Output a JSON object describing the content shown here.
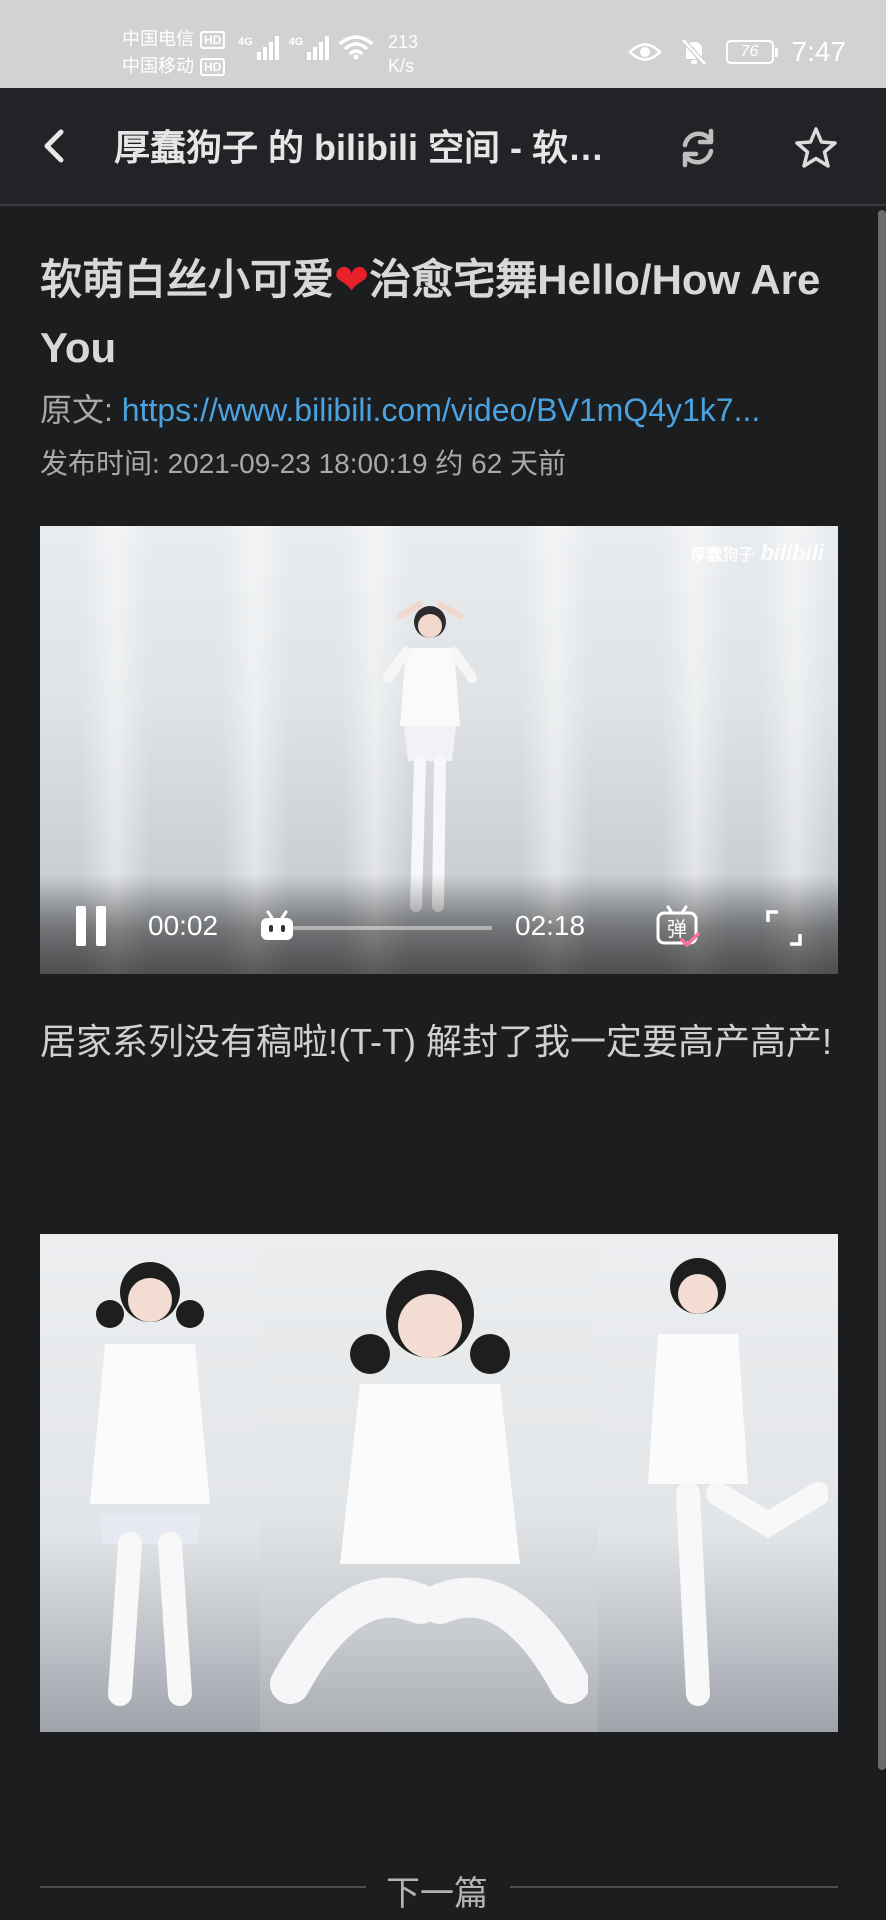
{
  "status_bar": {
    "carrier_1": "中国电信",
    "carrier_2": "中国移动",
    "hd_badge": "HD",
    "network_1": "4G",
    "network_2": "4G",
    "speed_value": "213",
    "speed_unit": "K/s",
    "battery": "76",
    "time": "7:47"
  },
  "app_bar": {
    "title": "厚蠢狗子 的 bilibili 空间 - 软萌白丝小可爱❤️治愈宅舞Hello/How Are You"
  },
  "article": {
    "title_part1": "软萌白丝小可爱",
    "title_heart": "❤",
    "title_part2": "治愈宅舞Hello/How Are You",
    "source_label": "原文:",
    "source_url": "https://www.bilibili.com/video/BV1mQ4y1k7...",
    "date_label": "发布时间:",
    "date_value": "2021-09-23 18:00:19 约 62 天前",
    "description": "居家系列没有稿啦!(T-T) 解封了我一定要高产高产!"
  },
  "video": {
    "watermark_user": "厚蠢狗子",
    "watermark_brand": "bilibili",
    "current_time": "00:02",
    "total_time": "02:18",
    "progress": 0.015,
    "danmaku_label": "弹"
  },
  "footer": {
    "next_label": "下一篇"
  }
}
